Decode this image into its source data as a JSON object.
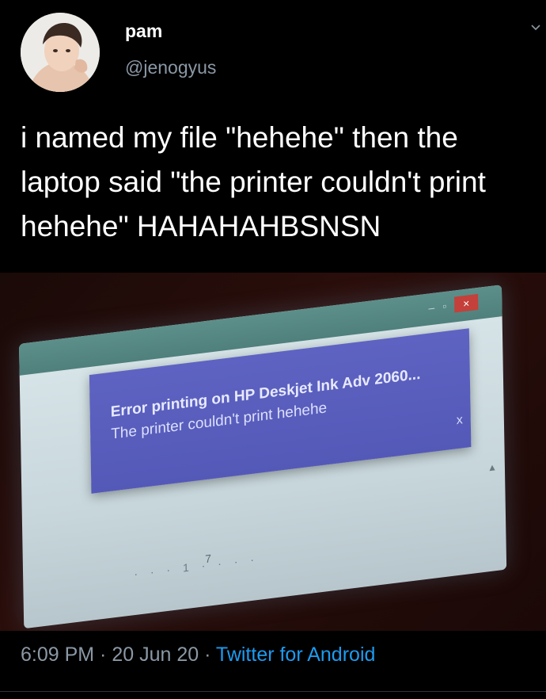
{
  "user": {
    "name": "pam",
    "handle": "@jenogyus"
  },
  "tweet": {
    "text": "i named my file \"hehehe\" then the laptop said \"the printer couldn't print hehehe\" HAHAHAHBSNSN"
  },
  "photo": {
    "window_controls": {
      "minimize": "–",
      "restore": "▫",
      "close": "×"
    },
    "notification": {
      "title": "Error printing on HP Deskjet Ink Adv 2060...",
      "body": "The printer couldn't print hehehe",
      "close": "x"
    },
    "ruler_marks": "· · · 1 · · · ·",
    "ruler_number": "7"
  },
  "meta": {
    "time": "6:09 PM",
    "separator": " · ",
    "date": "20 Jun 20",
    "source": "Twitter for Android"
  },
  "icons": {
    "menu": "chevron-down-icon",
    "avatar": "avatar-photo"
  },
  "colors": {
    "background": "#000000",
    "text": "#ffffff",
    "secondary": "#8b98a5",
    "link": "#1d9bf0"
  }
}
